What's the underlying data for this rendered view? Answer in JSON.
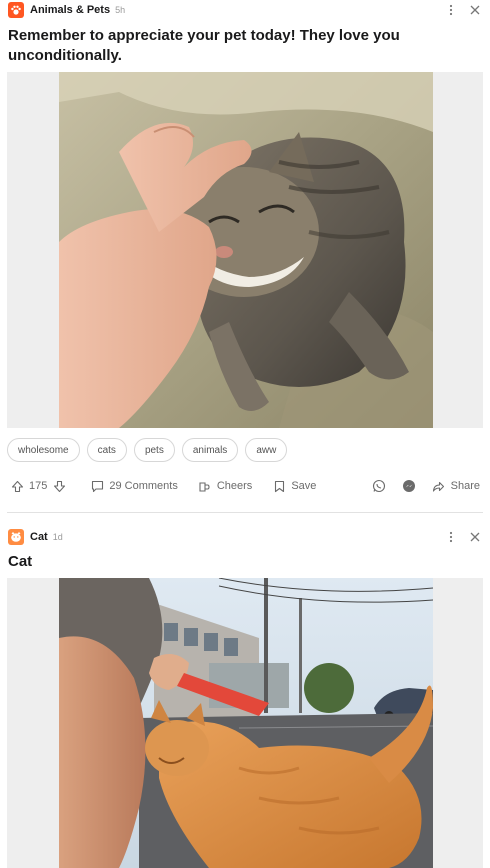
{
  "posts": [
    {
      "community": "Animals & Pets",
      "time": "5h",
      "title": "Remember to appreciate your pet today! They love you unconditionally.",
      "tags": [
        "wholesome",
        "cats",
        "pets",
        "animals",
        "aww"
      ],
      "votes": "175",
      "comments": "29 Comments",
      "cheers": "Cheers",
      "save": "Save",
      "share": "Share",
      "avatar_color": "#ff5722"
    },
    {
      "community": "Cat",
      "time": "1d",
      "title": "Cat",
      "avatar_color": "#ff8c42"
    }
  ],
  "icons": {
    "more": "more-vertical-icon",
    "close": "close-icon",
    "upvote": "arrow-up-icon",
    "downvote": "arrow-down-icon",
    "comment": "comment-icon",
    "cheers": "cheers-icon",
    "save": "bookmark-icon",
    "whatsapp": "whatsapp-icon",
    "messenger": "messenger-icon",
    "share": "share-arrow-icon"
  }
}
